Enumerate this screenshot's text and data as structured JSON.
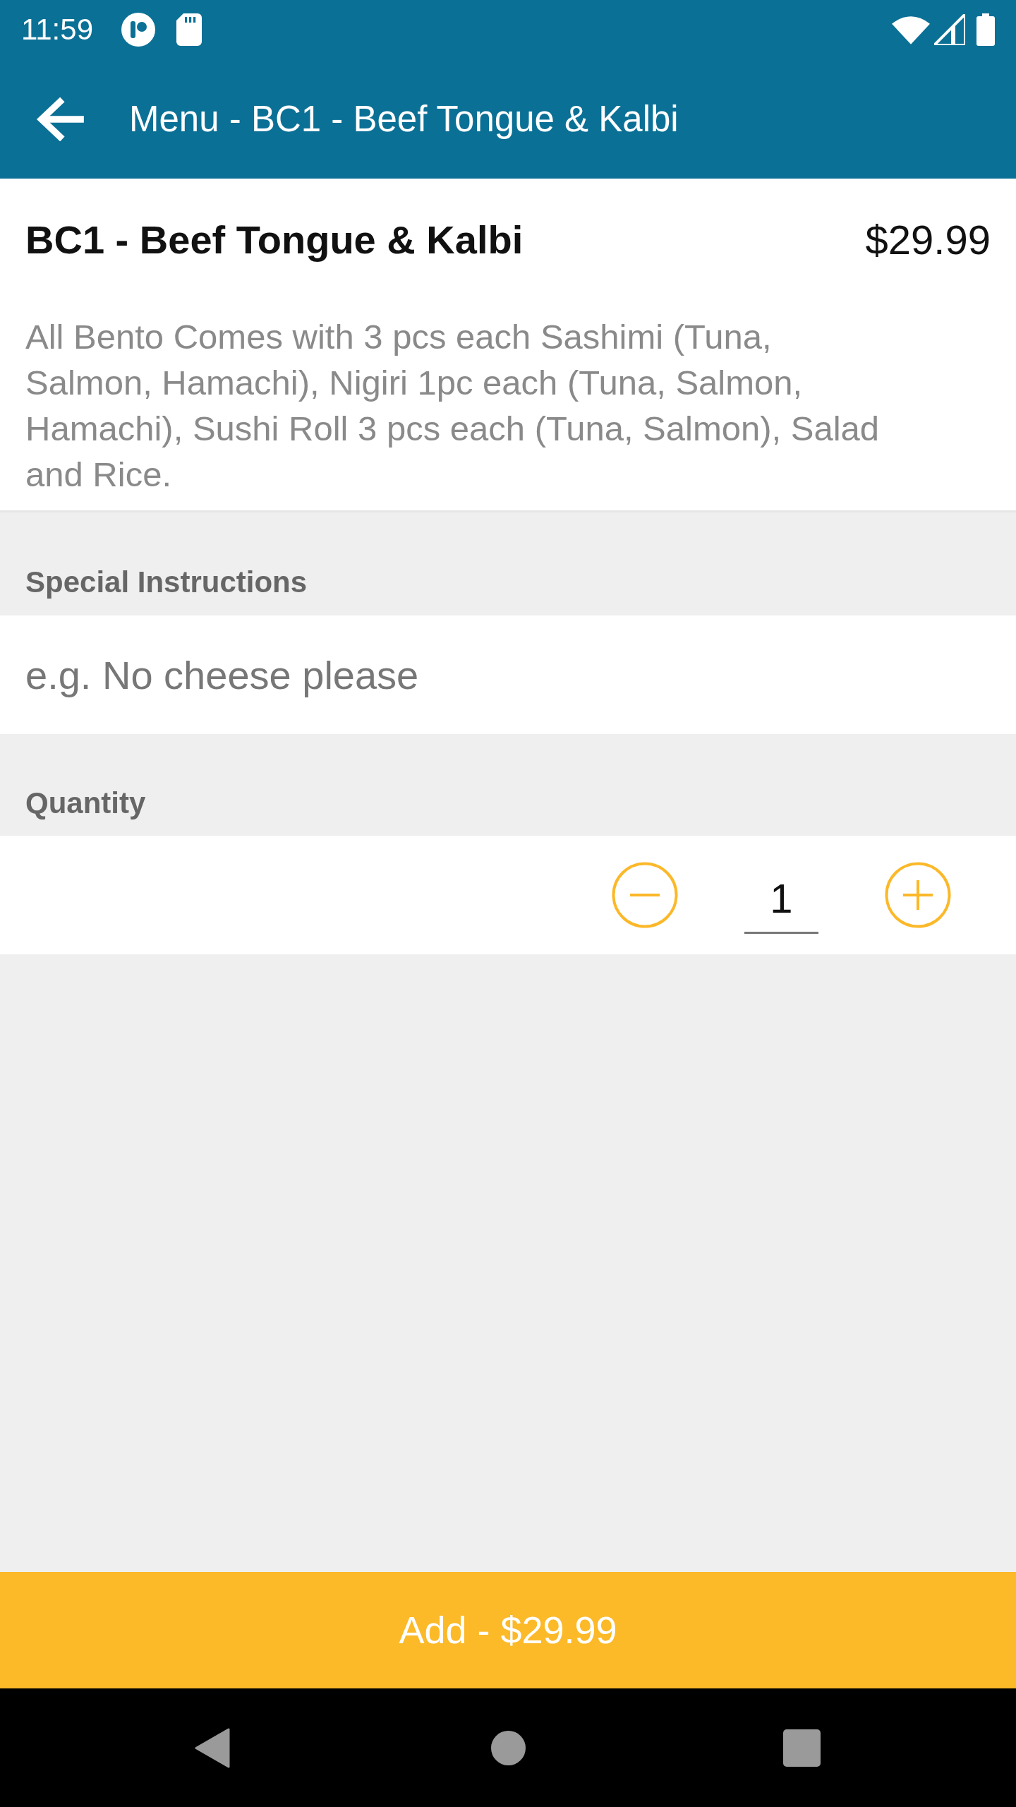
{
  "status_bar": {
    "time": "11:59"
  },
  "app_bar": {
    "title": "Menu - BC1 - Beef Tongue & Kalbi"
  },
  "item": {
    "name": "BC1 - Beef Tongue & Kalbi",
    "price": "$29.99",
    "description": "All Bento Comes with 3 pcs each Sashimi (Tuna, Salmon, Hamachi), Nigiri 1pc each (Tuna, Salmon, Hamachi), Sushi Roll 3 pcs each (Tuna, Salmon), Salad and Rice."
  },
  "special_instructions": {
    "label": "Special Instructions",
    "placeholder": "e.g. No cheese please"
  },
  "quantity": {
    "label": "Quantity",
    "value": "1"
  },
  "add_button": {
    "label": "Add - $29.99"
  }
}
